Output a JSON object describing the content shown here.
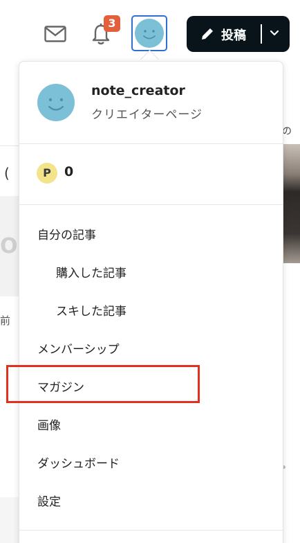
{
  "header": {
    "notification_count": "3",
    "post_button": {
      "label": "投稿"
    },
    "icons": [
      "mail-icon",
      "bell-icon",
      "avatar-smiley-icon",
      "pencil-icon",
      "chevron-down-icon"
    ]
  },
  "background": {
    "left_paren": "(",
    "left_fragment": "O",
    "left_mae": "前",
    "right_char": "の"
  },
  "dropdown": {
    "profile": {
      "name": "note_creator",
      "subtitle": "クリエイターページ"
    },
    "points": {
      "icon_letter": "P",
      "value": "0"
    },
    "menu": [
      {
        "id": "my-articles",
        "label": "自分の記事",
        "indent": false
      },
      {
        "id": "purchased-articles",
        "label": "購入した記事",
        "indent": true
      },
      {
        "id": "liked-articles",
        "label": "スキした記事",
        "indent": true
      },
      {
        "id": "membership",
        "label": "メンバーシップ",
        "indent": false
      },
      {
        "id": "magazine",
        "label": "マガジン",
        "indent": false,
        "highlighted": true
      },
      {
        "id": "images",
        "label": "画像",
        "indent": false
      },
      {
        "id": "dashboard",
        "label": "ダッシュボード",
        "indent": false
      },
      {
        "id": "settings",
        "label": "設定",
        "indent": false
      }
    ]
  },
  "colors": {
    "avatar": "#7cc0d8",
    "badge": "#e2603c",
    "post_button_bg": "#08131a",
    "avatar_focus_border": "#2f6fd0",
    "points_badge": "#f3e38a",
    "highlight_border": "#e0301e"
  }
}
